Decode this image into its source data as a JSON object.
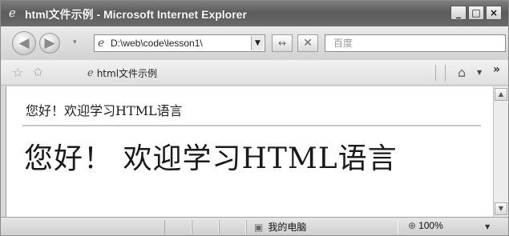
{
  "window": {
    "title": "html文件示例 - Microsoft Internet Explorer",
    "minimize_label": "_",
    "maximize_label": "□",
    "close_label": "×"
  },
  "navigation": {
    "back_glyph": "◀",
    "forward_glyph": "▶",
    "address": "D:\\web\\code\\lesson1\\",
    "refresh_glyph": "↔",
    "stop_glyph": "✕",
    "search_placeholder": "百度"
  },
  "favorites": {
    "tab_label": "html文件示例"
  },
  "page": {
    "heading_small": "您好！欢迎学习HTML语言",
    "heading_large": "您好！ 欢迎学习HTML语言"
  },
  "status": {
    "zone_label": "我的电脑",
    "zoom_label": "100%"
  },
  "icons": {
    "ie_logo": "ie-logo-icon",
    "back": "back-arrow-icon",
    "forward": "forward-arrow-icon",
    "page": "page-icon",
    "refresh": "refresh-icon",
    "stop": "stop-icon",
    "favorites_star": "favorites-star-icon",
    "add_favorite": "add-favorites-icon",
    "home": "home-icon",
    "computer": "computer-icon",
    "zoom": "zoom-icon"
  }
}
